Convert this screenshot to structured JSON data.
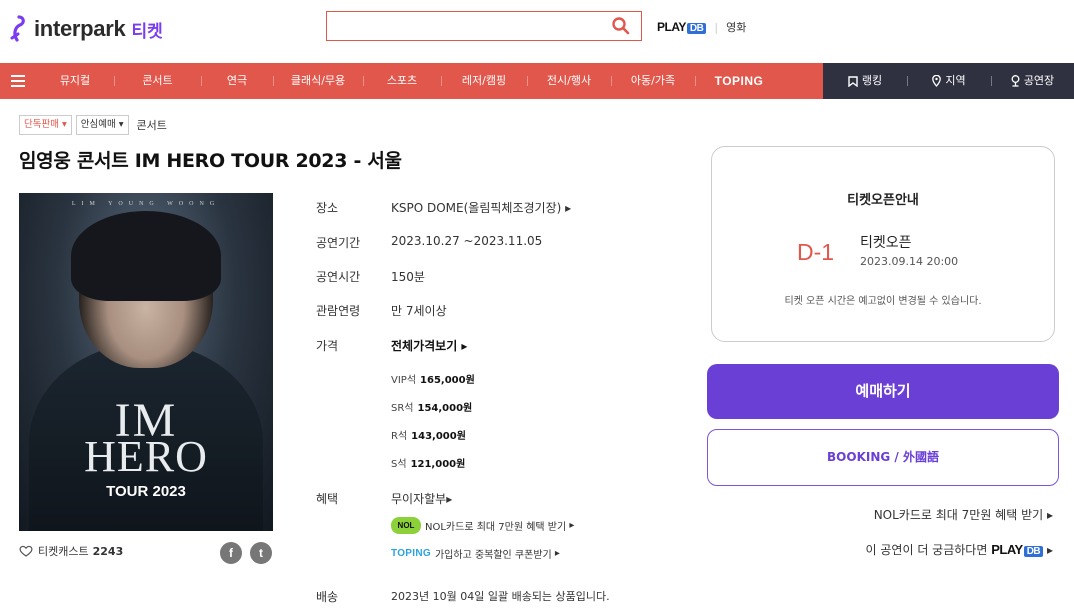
{
  "header": {
    "logo": "interpark",
    "logo_sub": "티켓",
    "search_placeholder": "",
    "playdb": "PLAY",
    "playdb_db": "DB",
    "movie": "영화"
  },
  "nav": {
    "items": [
      "뮤지컬",
      "콘서트",
      "연극",
      "클래식/무용",
      "스포츠",
      "레저/캠핑",
      "전시/행사",
      "아동/가족",
      "TOPING"
    ],
    "right_items": [
      "랭킹",
      "지역",
      "공연장"
    ]
  },
  "breadcrumb": {
    "chip1": "단독판매",
    "chip2": "안심예매",
    "category": "콘서트"
  },
  "title": "임영웅 콘서트 IM HERO TOUR 2023 - 서울",
  "poster": {
    "top_text": "LIM YOUNG WOONG",
    "im": "IM",
    "hero": "HERO",
    "tour": "TOUR 2023"
  },
  "cast": {
    "label": "티켓캐스트",
    "count": "2243"
  },
  "social": {
    "facebook": "f",
    "twitter": "t"
  },
  "info": {
    "venue_label": "장소",
    "venue_value": "KSPO DOME(올림픽체조경기장)",
    "period_label": "공연기간",
    "period_value": "2023.10.27 ~2023.11.05",
    "runtime_label": "공연시간",
    "runtime_value": "150분",
    "age_label": "관람연령",
    "age_value": "만 7세이상",
    "price_label": "가격",
    "price_value": "전체가격보기",
    "prices": [
      {
        "seat": "VIP석",
        "price": "165,000원"
      },
      {
        "seat": "SR석",
        "price": "154,000원"
      },
      {
        "seat": "R석",
        "price": "143,000원"
      },
      {
        "seat": "S석",
        "price": "121,000원"
      }
    ],
    "benefit_label": "혜택",
    "benefit_value": "무이자할부",
    "benefit_nol": "NOL카드로 최대 7만원 혜택 받기",
    "benefit_nol_badge": "NOL",
    "benefit_toping": "가입하고 중복할인 쿠폰받기",
    "benefit_toping_badge": "TOPING",
    "delivery_label": "배송",
    "delivery_value": "2023년 10월 04일 일괄 배송되는 상품입니다."
  },
  "ticket_open": {
    "title": "티켓오픈안내",
    "dday": "D-1",
    "label": "티켓오픈",
    "date": "2023.09.14 20:00",
    "note": "티켓 오픈 시간은 예고없이 변경될 수 있습니다."
  },
  "buttons": {
    "reserve": "예매하기",
    "booking": "BOOKING / 外國語"
  },
  "side_links": {
    "nol": "NOL카드로 최대 7만원 혜택 받기",
    "playdb_text": "이 공연이 더 궁금하다면",
    "playdb": "PLAY",
    "playdb_db": "DB"
  },
  "colors": {
    "brand_red": "#e2574c",
    "purple": "#6a3fd6",
    "nav_dark": "#2f3140"
  }
}
